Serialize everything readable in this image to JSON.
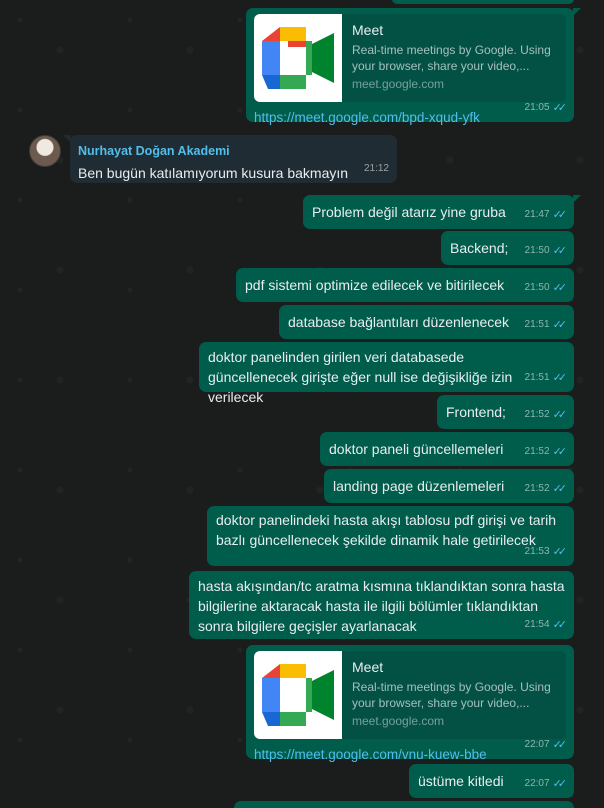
{
  "messages": {
    "m0": {
      "title": "Meet",
      "desc": "Real-time meetings by Google. Using your browser, share your video,...",
      "domain": "meet.google.com",
      "link": "https://meet.google.com/bpd-xqud-yfk",
      "time": "21:05"
    },
    "m1": {
      "sender": "Nurhayat Doğan Akademi",
      "text": "Ben bugün katılamıyorum kusura bakmayın",
      "time": "21:12"
    },
    "m2": {
      "text": "Problem değil atarız yine gruba",
      "time": "21:47"
    },
    "m3": {
      "text": "Backend;",
      "time": "21:50"
    },
    "m4": {
      "text": "pdf sistemi optimize edilecek ve bitirilecek",
      "time": "21:50"
    },
    "m5": {
      "text": "database bağlantıları düzenlenecek",
      "time": "21:51"
    },
    "m6": {
      "text": "doktor panelinden girilen veri databasede güncellenecek girişte eğer null ise değişikliğe izin verilecek",
      "time": "21:51"
    },
    "m7": {
      "text": "Frontend;",
      "time": "21:52"
    },
    "m8": {
      "text": "doktor paneli güncellemeleri",
      "time": "21:52"
    },
    "m9": {
      "text": "landing page düzenlemeleri",
      "time": "21:52"
    },
    "m10": {
      "text": "doktor panelindeki hasta akışı tablosu pdf girişi ve tarih bazlı güncellenecek şekilde dinamik hale getirilecek",
      "time": "21:53"
    },
    "m11": {
      "text": "hasta akışından/tc aratma kısmına tıklandıktan sonra hasta bilgilerine aktaracak hasta ile ilgili bölümler tıklandıktan sonra bilgilere geçişler ayarlanacak",
      "time": "21:54"
    },
    "m12": {
      "title": "Meet",
      "desc": "Real-time meetings by Google. Using your browser, share your video,...",
      "domain": "meet.google.com",
      "link": "https://meet.google.com/vnu-kuew-bbe",
      "time": "22:07"
    },
    "m13": {
      "text": "üstüme kitledi",
      "time": "22:07"
    }
  },
  "ticks": "✓✓",
  "colors": {
    "outgoing": "#005c4b",
    "incoming": "#202c33",
    "link": "#53bdeb",
    "sender": "#53bdeb"
  }
}
